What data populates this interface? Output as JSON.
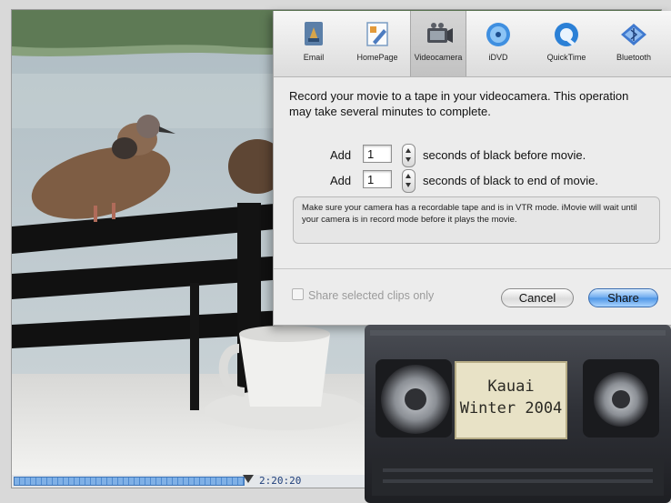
{
  "toolbar": {
    "items": [
      {
        "label": "Email",
        "icon": "email-icon"
      },
      {
        "label": "HomePage",
        "icon": "homepage-icon"
      },
      {
        "label": "Videocamera",
        "icon": "videocamera-icon",
        "selected": true
      },
      {
        "label": "iDVD",
        "icon": "idvd-icon"
      },
      {
        "label": "QuickTime",
        "icon": "quicktime-icon"
      },
      {
        "label": "Bluetooth",
        "icon": "bluetooth-icon"
      }
    ]
  },
  "panel": {
    "instructions": "Record your movie to a tape in your videocamera. This operation may take several minutes to complete.",
    "rows": [
      {
        "prefix": "Add",
        "value": "1",
        "suffix": "seconds of black before movie."
      },
      {
        "prefix": "Add",
        "value": "1",
        "suffix": "seconds of black to end of movie."
      }
    ],
    "note": "Make sure your camera has a recordable tape and is in VTR mode. iMovie will wait until your camera is in record mode before it plays the movie.",
    "share_selected_label": "Share selected clips only",
    "share_selected_checked": false,
    "cancel_label": "Cancel",
    "share_label": "Share"
  },
  "scrubber": {
    "timecode": "2:20:20"
  },
  "tape": {
    "label_line1": "Kauai",
    "label_line2": "Winter 2004"
  },
  "colors": {
    "accent": "#4d95e5",
    "sheet_bg": "#ececec",
    "tape_body": "#2c2e33"
  }
}
